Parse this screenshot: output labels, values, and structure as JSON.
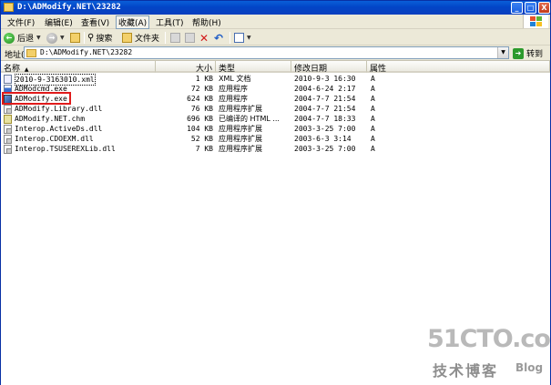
{
  "window": {
    "title": "D:\\ADModify.NET\\23282"
  },
  "title_buttons": {
    "minimize": "_",
    "maximize": "□",
    "close": "X"
  },
  "menubar": [
    {
      "label": "文件(F)"
    },
    {
      "label": "编辑(E)"
    },
    {
      "label": "查看(V)"
    },
    {
      "label": "收藏(A)"
    },
    {
      "label": "工具(T)"
    },
    {
      "label": "帮助(H)"
    }
  ],
  "toolbar": {
    "back_label": "后退",
    "search_label": "搜索",
    "folders_label": "文件夹"
  },
  "address": {
    "label": "地址(D)",
    "value": "D:\\ADModify.NET\\23282",
    "go_label": "转到"
  },
  "columns": [
    "名称",
    "大小",
    "类型",
    "修改日期",
    "属性"
  ],
  "files": [
    {
      "name": "2010-9-3163010.xml",
      "size": "1 KB",
      "type": "XML 文档",
      "modified": "2010-9-3 16:30",
      "attr": "A",
      "icon": "xml-file-icon"
    },
    {
      "name": "ADModcmd.exe",
      "size": "72 KB",
      "type": "应用程序",
      "modified": "2004-6-24 2:17",
      "attr": "A",
      "icon": "exe-file-icon"
    },
    {
      "name": "ADModify.exe",
      "size": "624 KB",
      "type": "应用程序",
      "modified": "2004-7-7 21:54",
      "attr": "A",
      "icon": "admodify-exe-icon"
    },
    {
      "name": "ADModify.Library.dll",
      "size": "76 KB",
      "type": "应用程序扩展",
      "modified": "2004-7-7 21:54",
      "attr": "A",
      "icon": "dll-file-icon"
    },
    {
      "name": "ADModify.NET.chm",
      "size": "696 KB",
      "type": "已编译的 HTML ...",
      "modified": "2004-7-7 18:33",
      "attr": "A",
      "icon": "chm-file-icon"
    },
    {
      "name": "Interop.ActiveDs.dll",
      "size": "104 KB",
      "type": "应用程序扩展",
      "modified": "2003-3-25 7:00",
      "attr": "A",
      "icon": "dll-file-icon"
    },
    {
      "name": "Interop.CDOEXM.dll",
      "size": "52 KB",
      "type": "应用程序扩展",
      "modified": "2003-6-3 3:14",
      "attr": "A",
      "icon": "dll-file-icon"
    },
    {
      "name": "Interop.TSUSEREXLib.dll",
      "size": "7 KB",
      "type": "应用程序扩展",
      "modified": "2003-3-25 7:00",
      "attr": "A",
      "icon": "dll-file-icon"
    }
  ],
  "watermark": {
    "brand": "51CTO.com",
    "sub": "技术博客",
    "blog": "Blog"
  },
  "colors": {
    "titlebar": "#0a4fd0",
    "highlight_box": "#e01b1b",
    "chrome": "#ece9d8"
  }
}
